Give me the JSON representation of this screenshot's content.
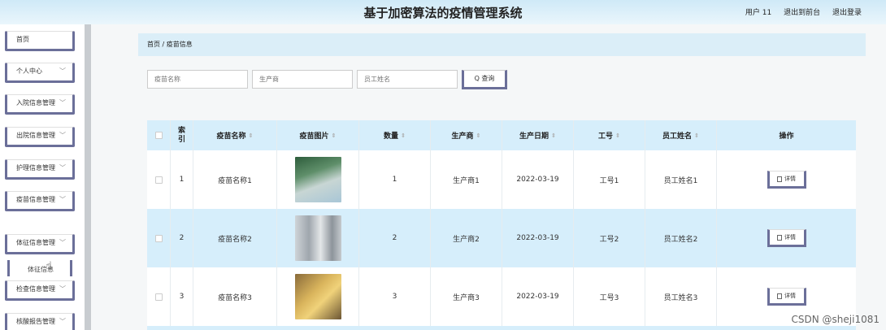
{
  "header": {
    "title": "基于加密算法的疫情管理系统",
    "user": "用户 11",
    "back_front": "退出到前台",
    "logout": "退出登录"
  },
  "sidebar": {
    "items": [
      {
        "label": "首页",
        "chevron": ""
      },
      {
        "label": "个人中心",
        "chevron": "﹀"
      },
      {
        "label": "入院信息管理",
        "chevron": "﹀"
      },
      {
        "label": "出院信息管理",
        "chevron": "﹀"
      },
      {
        "label": "护理信息管理",
        "chevron": "﹀"
      },
      {
        "label": "疫苗信息管理",
        "chevron": "﹀"
      },
      {
        "label": "体征信息管理",
        "chevron": "﹀"
      },
      {
        "label": "检查信息管理",
        "chevron": "﹀"
      },
      {
        "label": "核酸报告管理",
        "chevron": "﹀"
      }
    ],
    "sub_item": "体征信息"
  },
  "breadcrumb": "首页 / 疫苗信息",
  "search": {
    "vaccine_name_placeholder": "疫苗名称",
    "manufacturer_placeholder": "生产商",
    "staff_name_placeholder": "员工姓名",
    "button": "Q 查询"
  },
  "table": {
    "headers": {
      "index": "索引",
      "name": "疫苗名称",
      "image": "疫苗图片",
      "qty": "数量",
      "maker": "生产商",
      "date": "生产日期",
      "no": "工号",
      "staff": "员工姓名",
      "ops": "操作"
    },
    "rows": [
      {
        "index": "1",
        "name": "疫苗名称1",
        "qty": "1",
        "maker": "生产商1",
        "date": "2022-03-19",
        "no": "工号1",
        "staff": "员工姓名1"
      },
      {
        "index": "2",
        "name": "疫苗名称2",
        "qty": "2",
        "maker": "生产商2",
        "date": "2022-03-19",
        "no": "工号2",
        "staff": "员工姓名2"
      },
      {
        "index": "3",
        "name": "疫苗名称3",
        "qty": "3",
        "maker": "生产商3",
        "date": "2022-03-19",
        "no": "工号3",
        "staff": "员工姓名3"
      }
    ],
    "detail_label": "详情",
    "sort_icon": "⇕"
  },
  "watermark": "CSDN @sheji1081"
}
